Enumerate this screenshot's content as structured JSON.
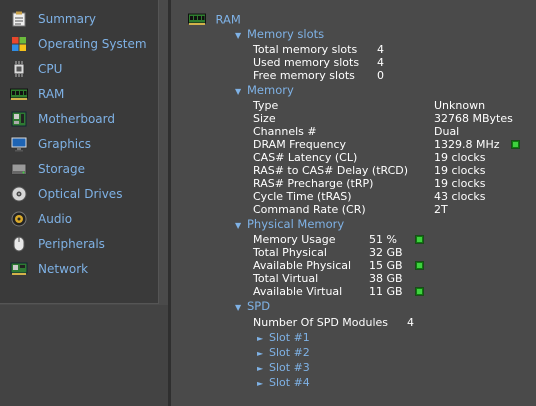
{
  "sidebar": {
    "items": [
      {
        "label": "Summary"
      },
      {
        "label": "Operating System"
      },
      {
        "label": "CPU"
      },
      {
        "label": "RAM"
      },
      {
        "label": "Motherboard"
      },
      {
        "label": "Graphics"
      },
      {
        "label": "Storage"
      },
      {
        "label": "Optical Drives"
      },
      {
        "label": "Audio"
      },
      {
        "label": "Peripherals"
      },
      {
        "label": "Network"
      }
    ]
  },
  "main": {
    "title": "RAM",
    "memory_slots": {
      "heading": "Memory slots",
      "rows": [
        {
          "label": "Total memory slots",
          "value": "4"
        },
        {
          "label": "Used memory slots",
          "value": "4"
        },
        {
          "label": "Free memory slots",
          "value": "0"
        }
      ]
    },
    "memory": {
      "heading": "Memory",
      "rows": [
        {
          "label": "Type",
          "value": "Unknown"
        },
        {
          "label": "Size",
          "value": "32768 MBytes"
        },
        {
          "label": "Channels #",
          "value": "Dual"
        },
        {
          "label": "DRAM Frequency",
          "value": "1329.8 MHz"
        },
        {
          "label": "CAS# Latency (CL)",
          "value": "19 clocks"
        },
        {
          "label": "RAS# to CAS# Delay (tRCD)",
          "value": "19 clocks"
        },
        {
          "label": "RAS# Precharge (tRP)",
          "value": "19 clocks"
        },
        {
          "label": "Cycle Time (tRAS)",
          "value": "43 clocks"
        },
        {
          "label": "Command Rate (CR)",
          "value": "2T"
        }
      ]
    },
    "physical_memory": {
      "heading": "Physical Memory",
      "rows": [
        {
          "label": "Memory Usage",
          "value": "51 %"
        },
        {
          "label": "Total Physical",
          "value": "32 GB"
        },
        {
          "label": "Available Physical",
          "value": "15 GB"
        },
        {
          "label": "Total Virtual",
          "value": "38 GB"
        },
        {
          "label": "Available Virtual",
          "value": "11 GB"
        }
      ]
    },
    "spd": {
      "heading": "SPD",
      "modules_label": "Number Of SPD Modules",
      "modules_value": "4",
      "slots": [
        {
          "label": "Slot #1"
        },
        {
          "label": "Slot #2"
        },
        {
          "label": "Slot #3"
        },
        {
          "label": "Slot #4"
        }
      ]
    }
  },
  "colors": {
    "accent": "#7fb2e6",
    "background": "#4a4a4a",
    "sidebar": "#3a3a3a",
    "led": "#3fd13f"
  }
}
